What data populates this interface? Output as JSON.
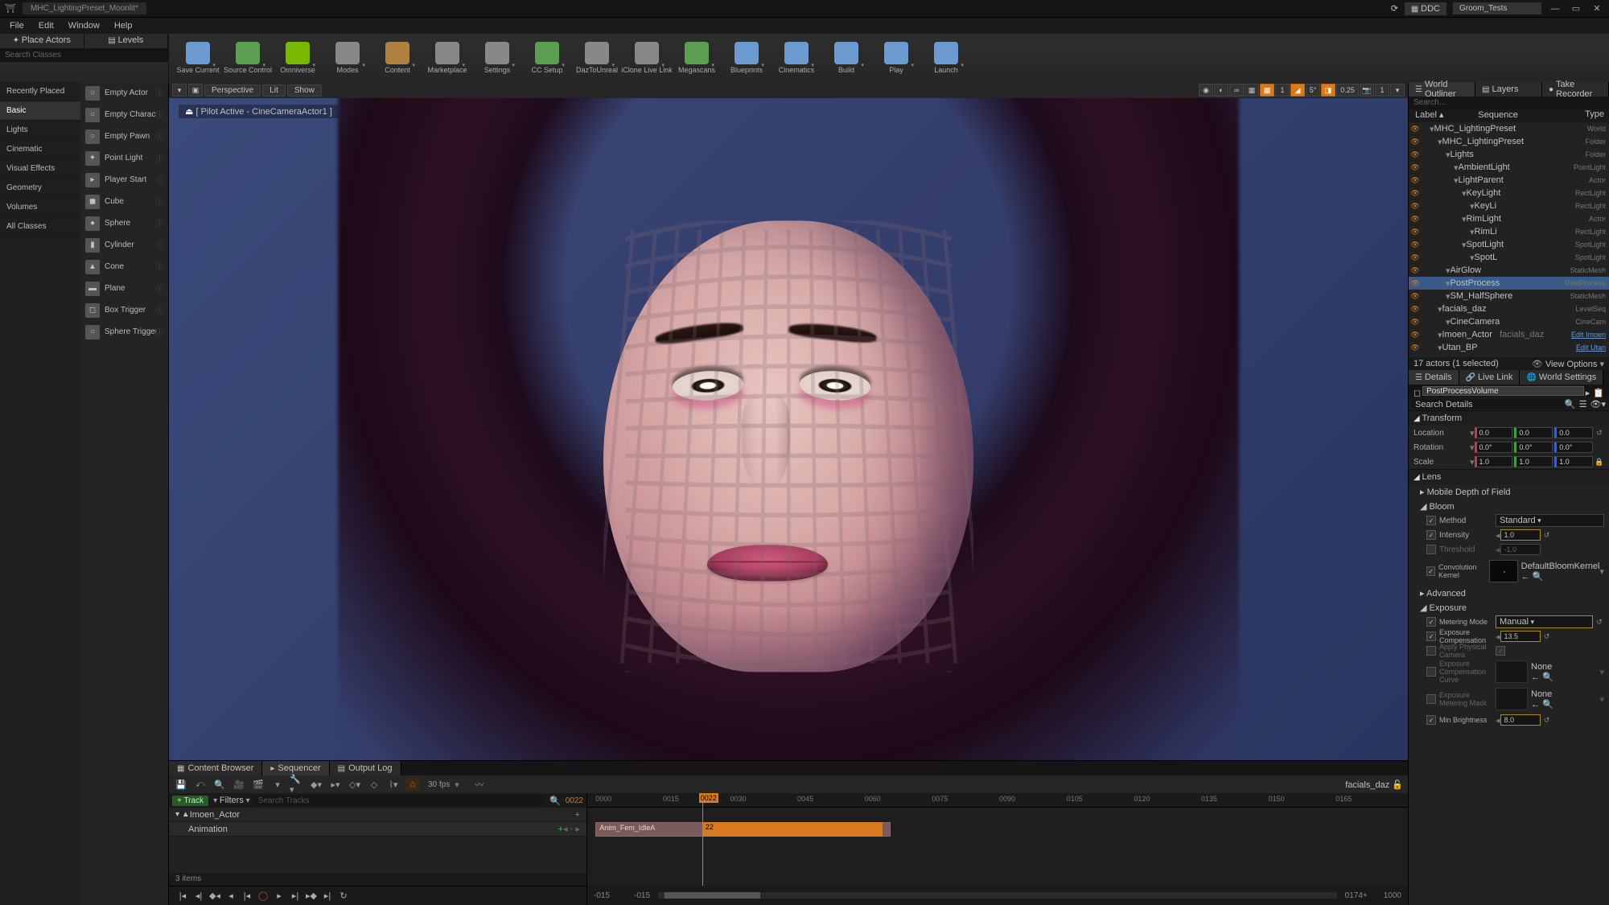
{
  "titlebar": {
    "tab": "MHC_LightingPreset_Moonlit*",
    "ddc": "DDC",
    "project": "Groom_Tests"
  },
  "menubar": [
    "File",
    "Edit",
    "Window",
    "Help"
  ],
  "placeactors_tabs": {
    "place": "Place Actors",
    "levels": "Levels"
  },
  "toolbar": [
    {
      "label": "Save Current",
      "color": "#6a9ad0"
    },
    {
      "label": "Source Control",
      "color": "#5aa050"
    },
    {
      "label": "Omniverse",
      "color": "#76b900"
    },
    {
      "label": "Modes",
      "color": "#888"
    },
    {
      "label": "Content",
      "color": "#b08040"
    },
    {
      "label": "Marketplace",
      "color": "#888"
    },
    {
      "label": "Settings",
      "color": "#888"
    },
    {
      "label": "CC Setup",
      "color": "#5aa050"
    },
    {
      "label": "DazToUnreal",
      "color": "#888"
    },
    {
      "label": "iClone Live Link",
      "color": "#888"
    },
    {
      "label": "Megascans",
      "color": "#5aa050"
    },
    {
      "label": "Blueprints",
      "color": "#6a9ad0"
    },
    {
      "label": "Cinematics",
      "color": "#6a9ad0"
    },
    {
      "label": "Build",
      "color": "#6a9ad0"
    },
    {
      "label": "Play",
      "color": "#6a9ad0"
    },
    {
      "label": "Launch",
      "color": "#6a9ad0"
    }
  ],
  "place": {
    "search": "Search Classes",
    "cats": [
      "Recently Placed",
      "Basic",
      "Lights",
      "Cinematic",
      "Visual Effects",
      "Geometry",
      "Volumes",
      "All Classes"
    ],
    "active_cat": "Basic",
    "items": [
      {
        "n": "Empty Actor",
        "i": "○"
      },
      {
        "n": "Empty Character",
        "i": "○"
      },
      {
        "n": "Empty Pawn",
        "i": "○"
      },
      {
        "n": "Point Light",
        "i": "✦"
      },
      {
        "n": "Player Start",
        "i": "▸"
      },
      {
        "n": "Cube",
        "i": "◼"
      },
      {
        "n": "Sphere",
        "i": "●"
      },
      {
        "n": "Cylinder",
        "i": "▮"
      },
      {
        "n": "Cone",
        "i": "▲"
      },
      {
        "n": "Plane",
        "i": "▬"
      },
      {
        "n": "Box Trigger",
        "i": "◻"
      },
      {
        "n": "Sphere Trigger",
        "i": "○"
      }
    ]
  },
  "viewport": {
    "mode_persp": "Perspective",
    "mode_lit": "Lit",
    "mode_show": "Show",
    "pilot": "[ Pilot Active - CineCameraActor1 ]",
    "grid_deg": "5°",
    "grid_step": "0.25",
    "cam_speed": "1"
  },
  "bottom_tabs": {
    "content": "Content Browser",
    "seq": "Sequencer",
    "log": "Output Log"
  },
  "sequencer": {
    "fps": "30 fps",
    "asset": "facials_daz",
    "addtrack": "+ Track",
    "filters": "Filters",
    "search": "Search Tracks",
    "frame": "0022",
    "rows": [
      {
        "n": "Imoen_Actor",
        "indent": 0
      },
      {
        "n": "Animation",
        "indent": 1
      }
    ],
    "status": "3 items",
    "ticks": [
      "0000",
      "0015",
      "0030",
      "0045",
      "0060",
      "0075",
      "0090",
      "0105",
      "0120",
      "0135",
      "0150",
      "0165"
    ],
    "clip_name": "Anim_Fem_IdleA",
    "clip_frame": "22",
    "transport_start": "-015",
    "transport_l": "-015",
    "transport_end": "0174+",
    "transport_r": "1000"
  },
  "outliner_tabs": {
    "world": "World Outliner",
    "layers": "Layers",
    "take": "Take Recorder"
  },
  "outliner": {
    "search": "Search...",
    "hdr_label": "Label",
    "hdr_seq": "Sequence",
    "hdr_type": "Type",
    "rows": [
      {
        "i": 1,
        "n": "MHC_LightingPreset",
        "t": "World"
      },
      {
        "i": 2,
        "n": "MHC_LightingPreset",
        "t": "Folder"
      },
      {
        "i": 3,
        "n": "Lights",
        "t": "Folder"
      },
      {
        "i": 4,
        "n": "AmbientLight",
        "t": "PointLight"
      },
      {
        "i": 4,
        "n": "LightParent",
        "t": "Actor"
      },
      {
        "i": 5,
        "n": "KeyLight",
        "t": "RectLight"
      },
      {
        "i": 6,
        "n": "KeyLi",
        "t": "RectLight"
      },
      {
        "i": 5,
        "n": "RimLight",
        "t": "Actor"
      },
      {
        "i": 6,
        "n": "RimLi",
        "t": "RectLight"
      },
      {
        "i": 5,
        "n": "SpotLight",
        "t": "SpotLight"
      },
      {
        "i": 6,
        "n": "SpotL",
        "t": "SpotLight"
      },
      {
        "i": 3,
        "n": "AirGlow",
        "t": "StaticMesh"
      },
      {
        "i": 3,
        "n": "PostProcess",
        "t": "PostProcess",
        "sel": true
      },
      {
        "i": 3,
        "n": "SM_HalfSphere",
        "t": "StaticMesh"
      },
      {
        "i": 2,
        "n": "facials_daz",
        "t": "LevelSeq"
      },
      {
        "i": 3,
        "n": "CineCamera",
        "t": "CineCam"
      },
      {
        "i": 2,
        "n": "Imoen_Actor",
        "s": "facials_daz",
        "t": "Edit Imoen",
        "link": true
      },
      {
        "i": 2,
        "n": "Utan_BP",
        "t": "Edit Utan",
        "link": true
      }
    ],
    "status": "17 actors (1 selected)",
    "viewopt": "View Options"
  },
  "details_tabs": {
    "details": "Details",
    "livelink": "Live Link",
    "world": "World Settings"
  },
  "details": {
    "name": "PostProcessVolume",
    "search": "Search Details",
    "sections": {
      "transform": "Transform",
      "lens": "Lens",
      "mobiledof": "Mobile Depth of Field",
      "bloom": "Bloom",
      "advanced": "Advanced",
      "exposure": "Exposure"
    },
    "transform": {
      "location_l": "Location",
      "location": [
        "0.0",
        "0.0",
        "0.0"
      ],
      "rotation_l": "Rotation",
      "rotation": [
        "0.0°",
        "0.0°",
        "0.0°"
      ],
      "scale_l": "Scale",
      "scale": [
        "1.0",
        "1.0",
        "1.0"
      ]
    },
    "bloom": {
      "method_l": "Method",
      "method": "Standard",
      "intensity_l": "Intensity",
      "intensity": "1.0",
      "threshold_l": "Threshold",
      "threshold": "-1.0",
      "conv_l": "Convolution Kernel",
      "conv_asset": "DefaultBloomKernel"
    },
    "exposure": {
      "metering_l": "Metering Mode",
      "metering": "Manual",
      "comp_l": "Exposure Compensation",
      "comp": "13.5",
      "apply_l": "Apply Physical Camera",
      "expcomp_l": "Exposure Compensation Curve",
      "expcomp": "None",
      "expmet_l": "Exposure Metering Mask",
      "expmet": "None",
      "minbright_l": "Min Brightness",
      "minbright": "8.0"
    }
  }
}
